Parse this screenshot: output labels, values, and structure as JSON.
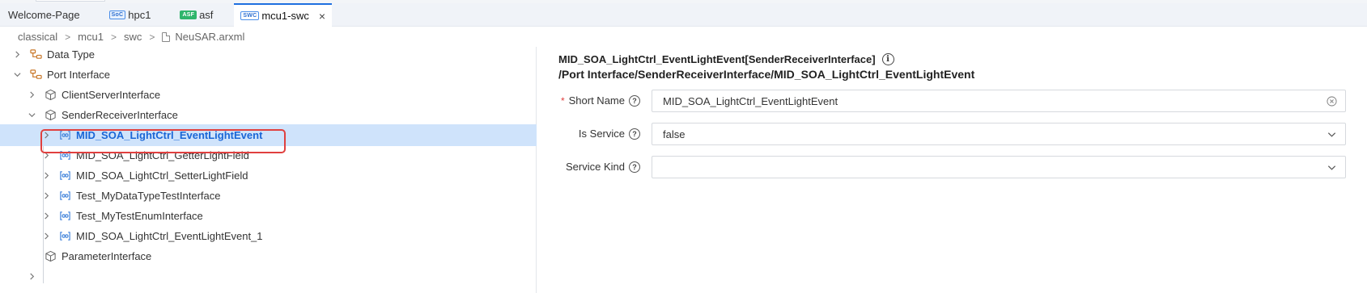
{
  "tabs": [
    {
      "label": "Welcome-Page",
      "badge": "",
      "active": false
    },
    {
      "label": "hpc1",
      "badge": "SoC",
      "active": false
    },
    {
      "label": "asf",
      "badge": "ASF",
      "active": false
    },
    {
      "label": "mcu1-swc",
      "badge": "SWC",
      "active": true,
      "close": "×"
    }
  ],
  "breadcrumb": [
    "classical",
    "mcu1",
    "swc",
    "NeuSAR.arxml"
  ],
  "tree": [
    {
      "label": "Data Type",
      "icon": "tree-node-icon",
      "chevron": "right"
    },
    {
      "label": "Port Interface",
      "icon": "tree-node-icon",
      "chevron": "down"
    },
    {
      "label": "ClientServerInterface",
      "icon": "cube-icon",
      "chevron": "right"
    },
    {
      "label": "SenderReceiverInterface",
      "icon": "cube-icon",
      "chevron": "down"
    },
    {
      "label": "MID_SOA_LightCtrl_EventLightEvent",
      "icon": "interface-icon",
      "chevron": "right",
      "selected": true
    },
    {
      "label": "MID_SOA_LightCtrl_GetterLightField",
      "icon": "interface-icon",
      "chevron": "right"
    },
    {
      "label": "MID_SOA_LightCtrl_SetterLightField",
      "icon": "interface-icon",
      "chevron": "right"
    },
    {
      "label": "Test_MyDataTypeTestInterface",
      "icon": "interface-icon",
      "chevron": "right"
    },
    {
      "label": "Test_MyTestEnumInterface",
      "icon": "interface-icon",
      "chevron": "right"
    },
    {
      "label": "MID_SOA_LightCtrl_EventLightEvent_1",
      "icon": "interface-icon",
      "chevron": "right"
    },
    {
      "label": "ParameterInterface",
      "icon": "cube-icon",
      "chevron": "none"
    }
  ],
  "detail": {
    "title": "MID_SOA_LightCtrl_EventLightEvent[SenderReceiverInterface]",
    "path": "/Port Interface/SenderReceiverInterface/MID_SOA_LightCtrl_EventLightEvent",
    "fields": {
      "short_name": {
        "label": "Short Name",
        "value": "MID_SOA_LightCtrl_EventLightEvent",
        "required": "*"
      },
      "is_service": {
        "label": "Is Service",
        "value": "false"
      },
      "service_kind": {
        "label": "Service Kind",
        "value": ""
      }
    }
  },
  "colors": {
    "accent": "#1e6fe0",
    "selection": "#cfe3fb",
    "highlight_box": "#e0403f",
    "tree_icon": "#c9782a",
    "interface_icon": "#3b7fd9"
  }
}
